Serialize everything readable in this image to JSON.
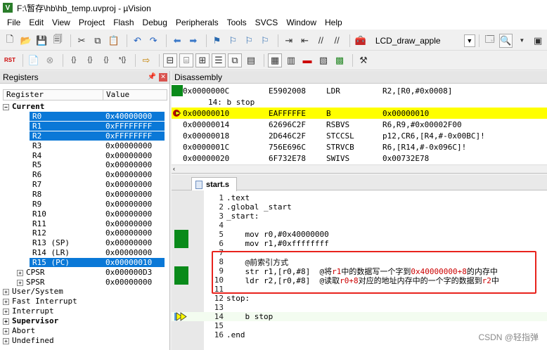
{
  "window": {
    "app_icon": "V",
    "title": "F:\\暂存\\hb\\hb_temp.uvproj - µVision"
  },
  "menu": [
    "File",
    "Edit",
    "View",
    "Project",
    "Flash",
    "Debug",
    "Peripherals",
    "Tools",
    "SVCS",
    "Window",
    "Help"
  ],
  "toolbar1": {
    "target_name": "LCD_draw_apple",
    "icons": [
      "new-file-icon",
      "open-folder-icon",
      "save-icon",
      "save-all-icon",
      "cut-icon",
      "copy-icon",
      "paste-icon",
      "undo-icon",
      "redo-icon",
      "nav-back-icon",
      "nav-forward-icon",
      "bookmark-set-icon",
      "bookmark-prev-icon",
      "bookmark-next-icon",
      "bookmark-clear-icon",
      "indent-icon",
      "unindent-icon",
      "comment-icon",
      "uncomment-icon",
      "find-in-files-icon",
      "target-options-icon",
      "search-icon"
    ]
  },
  "toolbar2": {
    "icons": [
      "reset-icon",
      "run-icon",
      "stop-icon",
      "step-into-icon",
      "step-over-icon",
      "step-out-icon",
      "run-to-cursor-icon",
      "show-next-statement-icon",
      "command-window-icon",
      "disassembly-window-icon",
      "symbols-window-icon",
      "registers-window-icon",
      "call-stack-icon",
      "watch-window-icon",
      "memory-window-icon",
      "serial-window-icon",
      "analysis-window-icon",
      "trace-window-icon",
      "system-viewer-icon",
      "toolbox-icon"
    ],
    "labels": {
      "reset": "RST"
    }
  },
  "registers": {
    "header": "Registers",
    "col_register": "Register",
    "col_value": "Value",
    "group_current": "Current",
    "rows": [
      {
        "name": "R0",
        "value": "0x40000000",
        "selected": true
      },
      {
        "name": "R1",
        "value": "0xFFFFFFFF",
        "selected": true
      },
      {
        "name": "R2",
        "value": "0xFFFFFFFF",
        "selected": true
      },
      {
        "name": "R3",
        "value": "0x00000000"
      },
      {
        "name": "R4",
        "value": "0x00000000"
      },
      {
        "name": "R5",
        "value": "0x00000000"
      },
      {
        "name": "R6",
        "value": "0x00000000"
      },
      {
        "name": "R7",
        "value": "0x00000000"
      },
      {
        "name": "R8",
        "value": "0x00000000"
      },
      {
        "name": "R9",
        "value": "0x00000000"
      },
      {
        "name": "R10",
        "value": "0x00000000"
      },
      {
        "name": "R11",
        "value": "0x00000000"
      },
      {
        "name": "R12",
        "value": "0x00000000"
      },
      {
        "name": "R13 (SP)",
        "value": "0x00000000"
      },
      {
        "name": "R14 (LR)",
        "value": "0x00000000"
      },
      {
        "name": "R15 (PC)",
        "value": "0x00000010",
        "selected": true
      },
      {
        "name": "CPSR",
        "value": "0x000000D3",
        "expandable": true
      },
      {
        "name": "SPSR",
        "value": "0x00000000",
        "expandable": true
      }
    ],
    "groups": [
      {
        "name": "User/System",
        "bold": false
      },
      {
        "name": "Fast Interrupt",
        "bold": false
      },
      {
        "name": "Interrupt",
        "bold": false
      },
      {
        "name": "Supervisor",
        "bold": true
      },
      {
        "name": "Abort",
        "bold": false
      },
      {
        "name": "Undefined",
        "bold": false
      }
    ]
  },
  "disassembly": {
    "header": "Disassembly",
    "rows": [
      {
        "addr": "0x0000000C",
        "code": "E5902008",
        "mn": "LDR",
        "ops": "R2,[R0,#0x0008]",
        "marker": "green"
      },
      {
        "src": "14:        b stop"
      },
      {
        "addr": "0x00000010",
        "code": "EAFFFFFE",
        "mn": "B",
        "ops": "0x00000010",
        "current": true,
        "marker": "pc"
      },
      {
        "addr": "0x00000014",
        "code": "62696C2F",
        "mn": "RSBVS",
        "ops": "R6,R9,#0x00002F00"
      },
      {
        "addr": "0x00000018",
        "code": "2D646C2F",
        "mn": "STCCSL",
        "ops": "p12,CR6,[R4,#-0x00BC]!"
      },
      {
        "addr": "0x0000001C",
        "code": "756E696C",
        "mn": "STRVCB",
        "ops": "R6,[R14,#-0x096C]!"
      },
      {
        "addr": "0x00000020",
        "code": "6F732E78",
        "mn": "SWIVS",
        "ops": "0x00732E78"
      }
    ]
  },
  "editor": {
    "tab_label": "start.s",
    "lines": [
      {
        "n": "1",
        "text": ".text"
      },
      {
        "n": "2",
        "text": ".global _start"
      },
      {
        "n": "3",
        "text": "_start:"
      },
      {
        "n": "4",
        "text": ""
      },
      {
        "n": "5",
        "text": "    mov r0,#0x40000000",
        "marker": "green"
      },
      {
        "n": "6",
        "text": "    mov r1,#0xffffffff",
        "marker": "green"
      },
      {
        "n": "7",
        "text": ""
      },
      {
        "n": "8",
        "text": "    @前索引方式"
      },
      {
        "n": "9",
        "text": "    str r1,[r0,#8]  @将r1中的数据写一个字到0x40000000+8的内存中",
        "marker": "green"
      },
      {
        "n": "10",
        "text": "    ldr r2,[r0,#8]  @读取r0+8对应的地址内存中的一个字的数据到r2中",
        "marker": "green"
      },
      {
        "n": "11",
        "text": ""
      },
      {
        "n": "12",
        "text": "stop:"
      },
      {
        "n": "13",
        "text": ""
      },
      {
        "n": "14",
        "text": "    b stop",
        "marker": "pc",
        "highlight": true
      },
      {
        "n": "15",
        "text": ""
      },
      {
        "n": "16",
        "text": ".end"
      }
    ]
  },
  "watermark": "CSDN @轻指弹"
}
